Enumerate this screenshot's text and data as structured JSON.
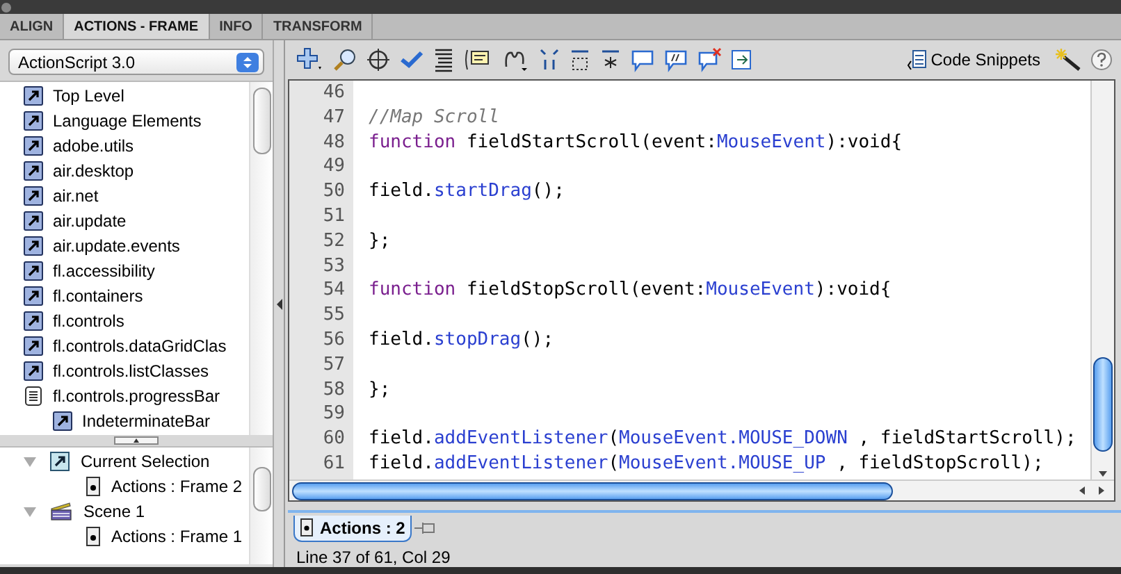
{
  "tabs": [
    {
      "label": "ALIGN",
      "selected": false
    },
    {
      "label": "ACTIONS - FRAME",
      "selected": true
    },
    {
      "label": "INFO",
      "selected": false
    },
    {
      "label": "TRANSFORM",
      "selected": false
    }
  ],
  "language_dropdown": {
    "value": "ActionScript 3.0"
  },
  "toolbox": [
    {
      "label": "Top Level",
      "kind": "package"
    },
    {
      "label": "Language Elements",
      "kind": "package"
    },
    {
      "label": "adobe.utils",
      "kind": "package"
    },
    {
      "label": "air.desktop",
      "kind": "package"
    },
    {
      "label": "air.net",
      "kind": "package"
    },
    {
      "label": "air.update",
      "kind": "package"
    },
    {
      "label": "air.update.events",
      "kind": "package"
    },
    {
      "label": "fl.accessibility",
      "kind": "package"
    },
    {
      "label": "fl.containers",
      "kind": "package"
    },
    {
      "label": "fl.controls",
      "kind": "package"
    },
    {
      "label": "fl.controls.dataGridClas",
      "kind": "package"
    },
    {
      "label": "fl.controls.listClasses",
      "kind": "package"
    },
    {
      "label": "fl.controls.progressBar",
      "kind": "book",
      "children": [
        {
          "label": "IndeterminateBar",
          "kind": "package"
        }
      ]
    }
  ],
  "script_navigator": [
    {
      "label": "Current Selection",
      "kind": "selection",
      "expanded": true,
      "children": [
        {
          "label": "Actions : Frame 2",
          "kind": "frame"
        }
      ]
    },
    {
      "label": "Scene 1",
      "kind": "scene",
      "expanded": true,
      "children": [
        {
          "label": "Actions : Frame 1",
          "kind": "frame"
        }
      ]
    }
  ],
  "toolbar": {
    "code_snippets": "Code Snippets"
  },
  "code_lines": [
    {
      "number": "46"
    },
    {
      "number": "47",
      "tokens": [
        {
          "kind": "comment",
          "text": "//Map Scroll"
        }
      ]
    },
    {
      "number": "48",
      "tokens": [
        {
          "kind": "keyword",
          "text": "function"
        },
        {
          "kind": "plain",
          "text": " fieldStartScroll(event:"
        },
        {
          "kind": "type",
          "text": "MouseEvent"
        },
        {
          "kind": "plain",
          "text": "):void{"
        }
      ]
    },
    {
      "number": "49"
    },
    {
      "number": "50",
      "tokens": [
        {
          "kind": "plain",
          "text": "field."
        },
        {
          "kind": "type",
          "text": "startDrag"
        },
        {
          "kind": "plain",
          "text": "();"
        }
      ]
    },
    {
      "number": "51"
    },
    {
      "number": "52",
      "tokens": [
        {
          "kind": "plain",
          "text": "};"
        }
      ]
    },
    {
      "number": "53"
    },
    {
      "number": "54",
      "tokens": [
        {
          "kind": "keyword",
          "text": "function"
        },
        {
          "kind": "plain",
          "text": " fieldStopScroll(event:"
        },
        {
          "kind": "type",
          "text": "MouseEvent"
        },
        {
          "kind": "plain",
          "text": "):void{"
        }
      ]
    },
    {
      "number": "55"
    },
    {
      "number": "56",
      "tokens": [
        {
          "kind": "plain",
          "text": "field."
        },
        {
          "kind": "type",
          "text": "stopDrag"
        },
        {
          "kind": "plain",
          "text": "();"
        }
      ]
    },
    {
      "number": "57"
    },
    {
      "number": "58",
      "tokens": [
        {
          "kind": "plain",
          "text": "};"
        }
      ]
    },
    {
      "number": "59"
    },
    {
      "number": "60",
      "tokens": [
        {
          "kind": "plain",
          "text": "field."
        },
        {
          "kind": "type",
          "text": "addEventListener"
        },
        {
          "kind": "plain",
          "text": "("
        },
        {
          "kind": "type",
          "text": "MouseEvent.MOUSE_DOWN"
        },
        {
          "kind": "plain",
          "text": " , fieldStartScroll);"
        }
      ]
    },
    {
      "number": "61",
      "tokens": [
        {
          "kind": "plain",
          "text": "field."
        },
        {
          "kind": "type",
          "text": "addEventListener"
        },
        {
          "kind": "plain",
          "text": "("
        },
        {
          "kind": "type",
          "text": "MouseEvent.MOUSE_UP"
        },
        {
          "kind": "plain",
          "text": " , fieldStopScroll);"
        }
      ]
    }
  ],
  "script_tabs": [
    {
      "label": "Actions : 2",
      "selected": true
    }
  ],
  "status_bar": "Line 37 of 61, Col 29"
}
